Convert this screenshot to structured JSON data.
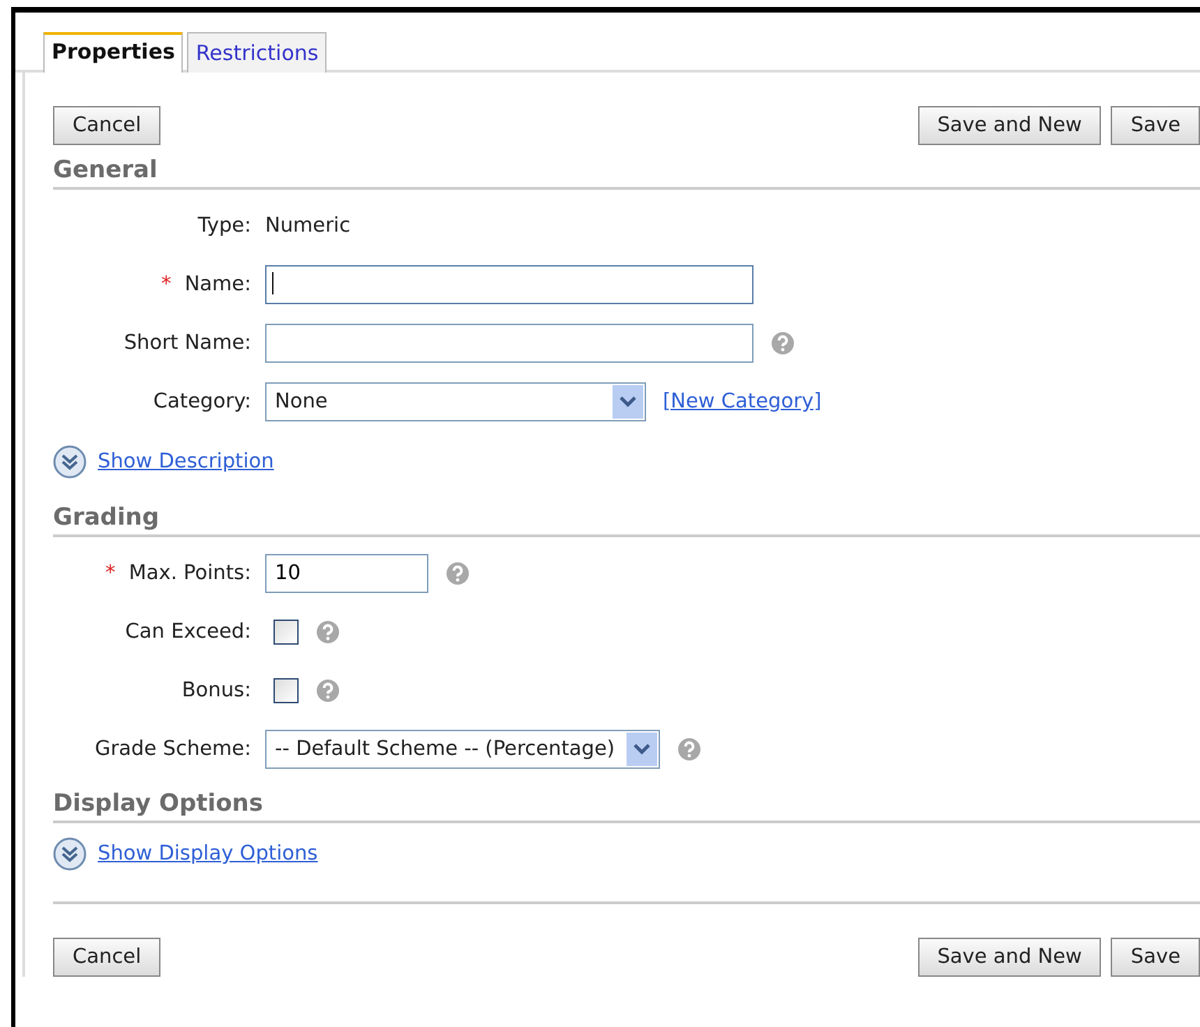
{
  "tabs": [
    {
      "label": "Properties",
      "selected": true
    },
    {
      "label": "Restrictions",
      "selected": false
    }
  ],
  "top_buttons": {
    "left": [
      "Cancel"
    ],
    "right": [
      "Save and New",
      "Save"
    ]
  },
  "sections": [
    {
      "title": "General",
      "rows": [
        {
          "kind": "text",
          "label": "Type:",
          "value": "Numeric"
        },
        {
          "kind": "input",
          "label": "Name:",
          "value": "",
          "marker": "*",
          "focused": true
        },
        {
          "kind": "input",
          "label": "Short Name:",
          "value": "",
          "help": true,
          "focused": false
        },
        {
          "kind": "select",
          "label": "Category:",
          "value": "None",
          "link": "[New Category]"
        }
      ],
      "expander": "Show Description"
    },
    {
      "title": "Grading",
      "rows": [
        {
          "kind": "input",
          "label": "Max. Points:",
          "value": "10",
          "marker": "*",
          "help": true,
          "focused": false
        },
        {
          "kind": "checkbox",
          "label": "Can Exceed:",
          "checked": false,
          "help": true
        },
        {
          "kind": "checkbox",
          "label": "Bonus:",
          "checked": false,
          "help": true
        },
        {
          "kind": "select",
          "label": "Grade Scheme:",
          "value": "-- Default Scheme -- (Percentage)",
          "help": true
        }
      ]
    },
    {
      "title": "Display Options",
      "expander": "Show Display Options"
    }
  ],
  "bottom_buttons": {
    "left": [
      "Cancel"
    ],
    "right": [
      "Save and New",
      "Save"
    ]
  }
}
